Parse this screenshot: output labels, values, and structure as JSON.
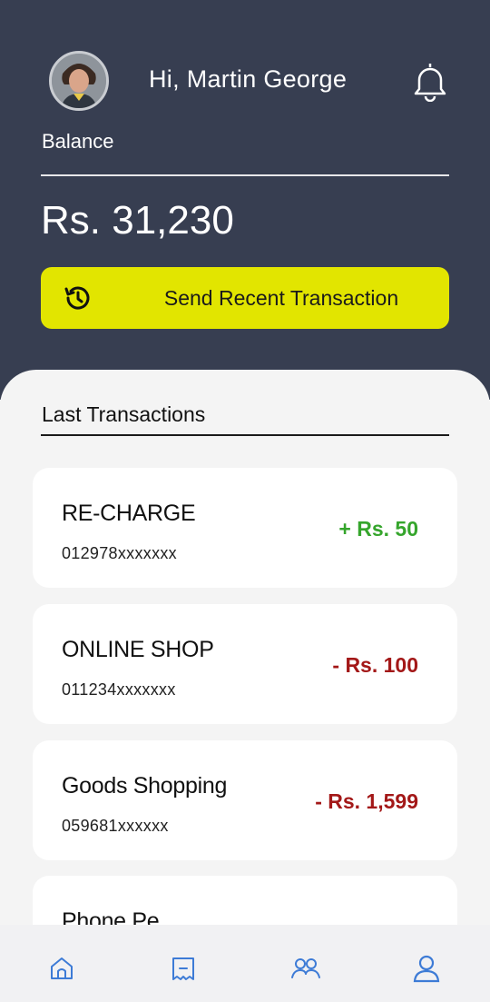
{
  "header": {
    "greeting": "Hi, Martin George",
    "balance_label": "Balance",
    "balance_amount": "Rs. 31,230",
    "send_button_label": "Send Recent Transaction"
  },
  "transactions": {
    "title": "Last Transactions",
    "items": [
      {
        "title": "RE-CHARGE",
        "account": "012978xxxxxxx",
        "amount": "+  Rs. 50",
        "type": "credit"
      },
      {
        "title": "ONLINE SHOP",
        "account": "011234xxxxxxx",
        "amount": "-  Rs. 100",
        "type": "debit"
      },
      {
        "title": "Goods Shopping",
        "account": "059681xxxxxx",
        "amount": "-  Rs. 1,599",
        "type": "debit"
      },
      {
        "title": "Phone Pe",
        "account": "",
        "amount": "",
        "type": "debit"
      }
    ]
  },
  "nav": {
    "items": [
      {
        "icon": "home-icon"
      },
      {
        "icon": "receipt-icon"
      },
      {
        "icon": "group-icon"
      },
      {
        "icon": "profile-icon"
      }
    ]
  },
  "colors": {
    "header_bg": "#373e51",
    "accent_yellow": "#e2e500",
    "credit_green": "#35a52c",
    "debit_red": "#a31818",
    "nav_icon_blue": "#3d7bd6"
  }
}
